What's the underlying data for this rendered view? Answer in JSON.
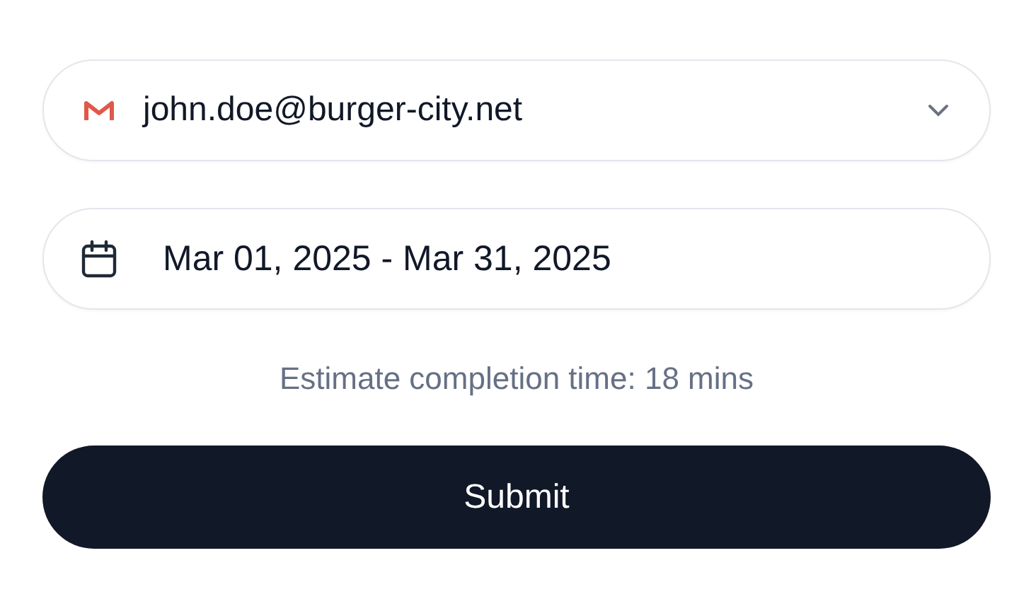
{
  "account_select": {
    "value": "john.doe@burger-city.net"
  },
  "date_range": {
    "value": "Mar 01, 2025 - Mar 31, 2025"
  },
  "estimate": "Estimate completion time: 18 mins",
  "buttons": [
    "Submit"
  ]
}
